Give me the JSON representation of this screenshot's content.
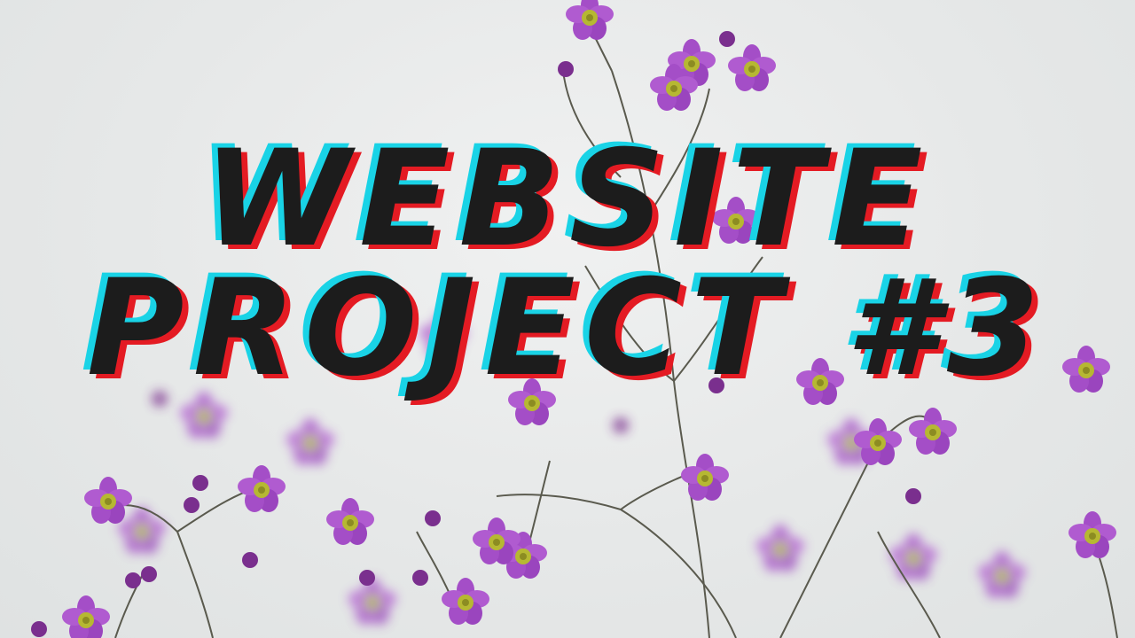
{
  "headline": {
    "line1": "WEBSITE",
    "line2": "PROJECT #3"
  },
  "colors": {
    "background": "#e7e9e9",
    "text": "#1c1c1c",
    "cyan_offset": "#19d3e6",
    "red_offset": "#e41b23",
    "petal": "#a44ec7",
    "petal_dark": "#7a2f8e",
    "flower_center": "#b6b832",
    "stem": "#5a5a4e"
  }
}
